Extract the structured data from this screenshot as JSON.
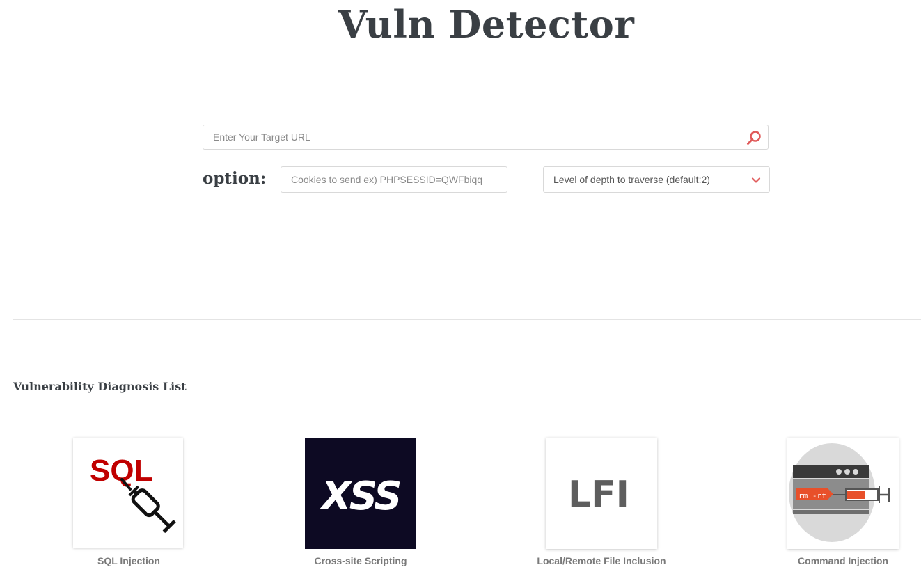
{
  "header": {
    "title": "Vuln Detector"
  },
  "search": {
    "placeholder": "Enter Your Target URL",
    "value": ""
  },
  "options": {
    "label": "option:",
    "cookies_placeholder": "Cookies to send ex) PHPSESSID=QWFbiqq",
    "depth_selected": "Level of depth to traverse (default:2)"
  },
  "section": {
    "title": "Vulnerability Diagnosis List"
  },
  "vulns": [
    {
      "label": "SQL Injection",
      "logo_text": "SQL",
      "icon": "sql-injection-syringe-icon"
    },
    {
      "label": "Cross-site Scripting",
      "logo_text": "XSS",
      "icon": "xss-logo"
    },
    {
      "label": "Local/Remote File Inclusion",
      "logo_text": "LFI",
      "icon": "lfi-logo"
    },
    {
      "label": "Command Injection",
      "logo_text": "rm -rf",
      "icon": "command-injection-syringe-icon"
    }
  ],
  "colors": {
    "accent": "#e05a5a",
    "sql_red": "#c00000",
    "xss_bg": "#0d0a23",
    "lfi_gray": "#5e5e5e",
    "cmd_orange": "#e8502a"
  }
}
